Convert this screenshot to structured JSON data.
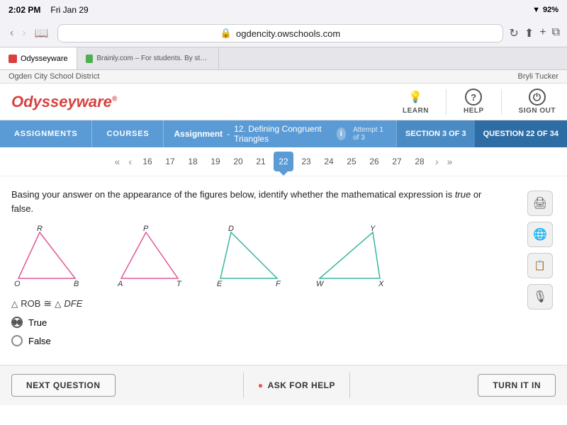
{
  "status_bar": {
    "time": "2:02 PM",
    "date": "Fri Jan 29",
    "wifi": "wifi",
    "battery": "92%"
  },
  "browser": {
    "url": "ogdencity.owschools.com",
    "lock_icon": "🔒",
    "tab1_label": "Odysseyware",
    "tab2_label": "Brainly.com – For students. By students."
  },
  "district_bar": {
    "left": "Ogden City School District",
    "right": "Bryli Tucker"
  },
  "header": {
    "logo": "Odysseyware",
    "logo_reg": "®",
    "learn_label": "LEARN",
    "help_label": "HELP",
    "signout_label": "SIGN OUT"
  },
  "nav": {
    "assignments_label": "ASSIGNMENTS",
    "courses_label": "COURSES",
    "assignment_prefix": "Assignment",
    "assignment_title": "12. Defining Congruent Triangles",
    "attempt": "Attempt 1 of 3",
    "section_label": "SECTION 3 OF 3",
    "question_label": "QUESTION 22 OF 34"
  },
  "pagination": {
    "pages": [
      "16",
      "17",
      "18",
      "19",
      "20",
      "21",
      "22",
      "23",
      "24",
      "25",
      "26",
      "27",
      "28"
    ],
    "active": "22"
  },
  "question": {
    "text_part1": "Basing your answer on the appearance of the figures below, identify whether the mathematical expression is ",
    "text_italic": "true",
    "text_part2": " or",
    "text_part3": "false.",
    "notation_left_sym": "△",
    "notation_left_text": "ROB",
    "notation_congruent": "≅",
    "notation_right_sym": "△",
    "notation_right_text": "DFE",
    "option_true": "True",
    "option_false": "False",
    "selected": "True"
  },
  "tools": {
    "print_icon": "🖨",
    "globe_icon": "🌐",
    "calculator_icon": "📋",
    "mic_icon": "🎙"
  },
  "footer": {
    "next_question_label": "NEXT QUESTION",
    "ask_help_icon": "●",
    "ask_help_label": "ASK FOR HELP",
    "turn_in_label": "TURN IT IN"
  }
}
